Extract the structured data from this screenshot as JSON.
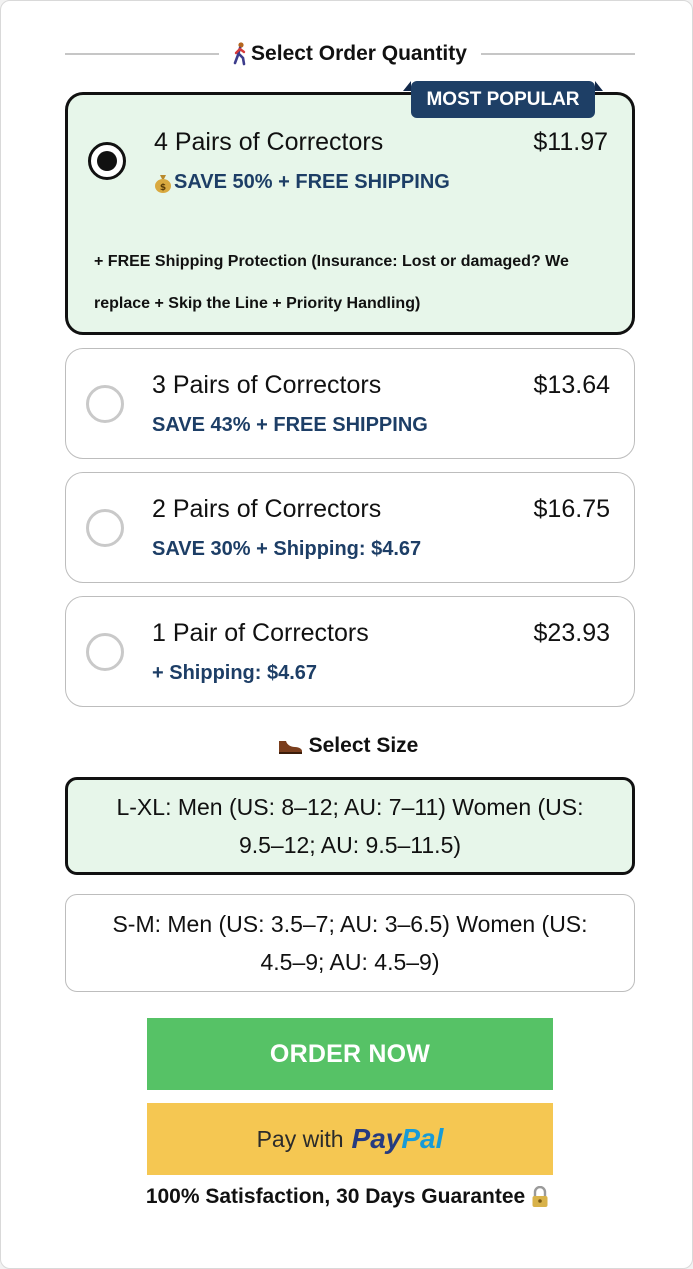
{
  "quantity_section": {
    "heading": "Select Order Quantity",
    "heading_icon": "person-walking-icon",
    "badge": "MOST POPULAR",
    "options": [
      {
        "title": "4 Pairs of Correctors",
        "price": "$11.97",
        "subtitle": "SAVE 50% + FREE SHIPPING",
        "subtitle_icon": "money-bag-icon",
        "protection_line1": "+ FREE Shipping Protection (Insurance: Lost or damaged? We",
        "protection_line2": "replace + Skip the Line + Priority Handling)",
        "selected": true
      },
      {
        "title": "3 Pairs of Correctors",
        "price": "$13.64",
        "subtitle": "SAVE 43% + FREE SHIPPING",
        "selected": false
      },
      {
        "title": "2 Pairs of Correctors",
        "price": "$16.75",
        "subtitle": "SAVE 30% + Shipping: $4.67",
        "selected": false
      },
      {
        "title": "1 Pair of Correctors",
        "price": "$23.93",
        "subtitle": "+ Shipping: $4.67",
        "selected": false
      }
    ]
  },
  "size_section": {
    "heading": "Select Size",
    "heading_icon": "shoe-icon",
    "options": [
      {
        "label": "L-XL: Men (US: 8–12; AU: 7–11) Women (US: 9.5–12; AU: 9.5–11.5)",
        "selected": true
      },
      {
        "label": "S-M: Men (US: 3.5–7; AU: 3–6.5) Women (US: 4.5–9; AU: 4.5–9)",
        "selected": false
      }
    ]
  },
  "actions": {
    "order_label": "ORDER NOW",
    "paypal_prefix": "Pay with",
    "paypal_logo_pay": "Pay",
    "paypal_logo_pal": "Pal"
  },
  "guarantee": {
    "text": "100% Satisfaction, 30 Days Guarantee",
    "icon": "lock-icon"
  },
  "colors": {
    "selected_bg": "#e7f6ea",
    "accent_navy": "#1e3f66",
    "order_green": "#56c266",
    "paypal_yellow": "#f5c752"
  }
}
